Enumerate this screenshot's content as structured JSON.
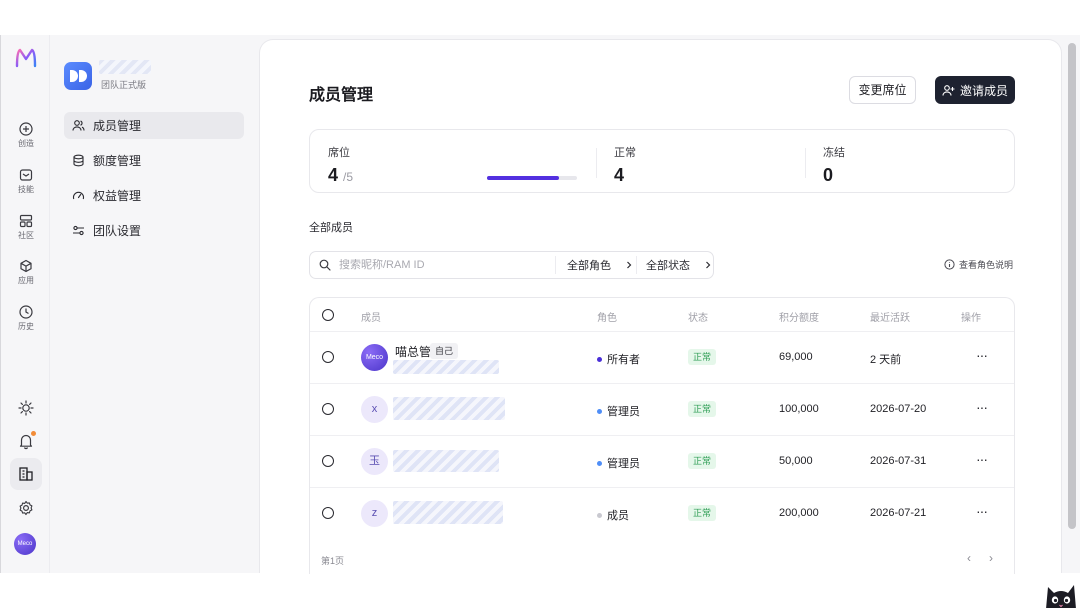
{
  "nav": {
    "items": [
      {
        "label": "创造",
        "icon": "plus-circle-icon"
      },
      {
        "label": "技能",
        "icon": "skills-icon"
      },
      {
        "label": "社区",
        "icon": "community-icon"
      },
      {
        "label": "应用",
        "icon": "cube-icon"
      },
      {
        "label": "历史",
        "icon": "clock-icon"
      }
    ],
    "bottom_icons": [
      "sun-icon",
      "bell-icon",
      "team-building-icon",
      "gear-icon"
    ],
    "avatar_text": "Meco"
  },
  "sidebar": {
    "team_plan": "团队正式版",
    "items": [
      {
        "label": "成员管理",
        "icon": "users-icon",
        "active": true
      },
      {
        "label": "额度管理",
        "icon": "database-icon",
        "active": false
      },
      {
        "label": "权益管理",
        "icon": "gauge-icon",
        "active": false
      },
      {
        "label": "团队设置",
        "icon": "sliders-icon",
        "active": false
      }
    ]
  },
  "page": {
    "title": "成员管理",
    "change_seats_label": "变更席位",
    "invite_label": "邀请成员"
  },
  "stats": {
    "seats_label": "席位",
    "seats_used": "4",
    "seats_total": "/5",
    "seats_progress": 0.8,
    "normal_label": "正常",
    "normal_value": "4",
    "frozen_label": "冻结",
    "frozen_value": "0"
  },
  "members_section": {
    "label": "全部成员",
    "search_placeholder": "搜索昵称/RAM ID",
    "role_filter": "全部角色",
    "status_filter": "全部状态",
    "role_help": "查看角色说明"
  },
  "table": {
    "headers": {
      "member": "成员",
      "role": "角色",
      "status": "状态",
      "quota": "积分额度",
      "last_active": "最近活跃",
      "actions": "操作"
    },
    "rows": [
      {
        "avatar": "Meco",
        "name": "喵总管",
        "tag": "自己",
        "role": "所有者",
        "role_color": "#4a2fd8",
        "status": "正常",
        "quota": "69,000",
        "last_active": "2 天前",
        "actions": "···"
      },
      {
        "avatar": "x",
        "role": "管理员",
        "role_color": "#4f8ef7",
        "status": "正常",
        "quota": "100,000",
        "last_active": "2026-07-20",
        "actions": "···"
      },
      {
        "avatar": "玉",
        "role": "管理员",
        "role_color": "#4f8ef7",
        "status": "正常",
        "quota": "50,000",
        "last_active": "2026-07-31",
        "actions": "···"
      },
      {
        "avatar": "z",
        "role": "成员",
        "role_color": "#c9c9d0",
        "status": "正常",
        "quota": "200,000",
        "last_active": "2026-07-21",
        "actions": "···"
      }
    ],
    "page_label": "第1页",
    "prev": "‹",
    "next": "›"
  }
}
